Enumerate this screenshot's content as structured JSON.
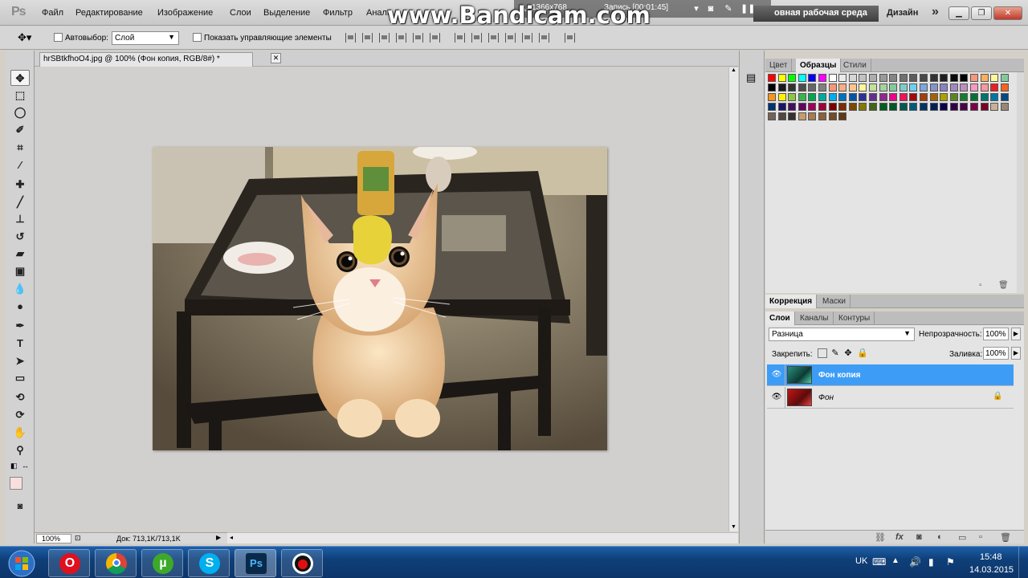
{
  "app": {
    "logo": "Ps",
    "menu": [
      "Файл",
      "Редактирование",
      "Изображение",
      "Слои",
      "Выделение",
      "Фильтр",
      "Анали"
    ],
    "workspace": "овная рабочая среда",
    "workspace_design": "Дизайн",
    "more": "»"
  },
  "recorder": {
    "resolution": "1366x768",
    "status": "Запись [00:01:45]",
    "watermark": "www.Bandicam.com"
  },
  "options": {
    "autoselect_label": "Автовыбор:",
    "autoselect_value": "Слой",
    "show_controls_label": "Показать управляющие элементы"
  },
  "document": {
    "tab_title": "hrSBtkfhoO4.jpg @ 100% (Фон копия, RGB/8#) *",
    "zoom": "100%",
    "doc_info": "Док: 713,1K/713,1K"
  },
  "panels": {
    "swatch_tabs": [
      "Цвет",
      "Образцы",
      "Стили"
    ],
    "swatch_active": 1,
    "adjust_tabs": [
      "Коррекция",
      "Маски"
    ],
    "layer_tabs": [
      "Слои",
      "Каналы",
      "Контуры"
    ],
    "blend_mode": "Разница",
    "opacity_label": "Непрозрачность:",
    "opacity_value": "100%",
    "lock_label": "Закрепить:",
    "fill_label": "Заливка:",
    "fill_value": "100%",
    "layers": [
      {
        "name": "Фон копия",
        "selected": true
      },
      {
        "name": "Фон",
        "selected": false,
        "locked": true
      }
    ]
  },
  "taskbar": {
    "lang": "UK",
    "time": "15:48",
    "date": "14.03.2015",
    "apps": [
      "opera-icon",
      "chrome-icon",
      "utorrent-icon",
      "skype-icon",
      "photoshop-icon",
      "bandicam-icon"
    ]
  },
  "colors": {
    "selected_layer": "#3d9df6",
    "taskbar": "#0f3f79"
  }
}
